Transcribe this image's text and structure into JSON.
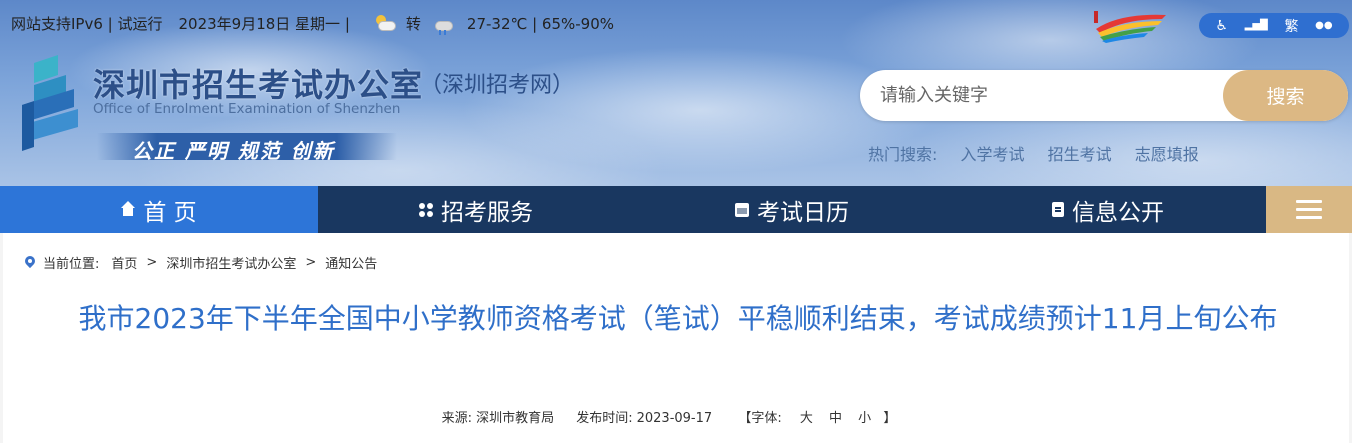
{
  "topbar": {
    "site_info": "网站支持IPv6 | 试运行",
    "date": "2023年9月18日 星期一 |",
    "weather_transition": "转",
    "weather_detail": "27-32℃ | 65%-90%",
    "weather_icons": [
      "sun-cloud-icon",
      "cloud-rain-icon"
    ]
  },
  "accessibility": {
    "items": [
      {
        "icon": "accessibility-icon",
        "label": "♿"
      },
      {
        "icon": "chart-icon",
        "label": "▂▅█"
      },
      {
        "icon": "traditional-chinese",
        "label": "繁"
      },
      {
        "icon": "wechat-icon",
        "label": "●●"
      }
    ]
  },
  "branding": {
    "title": "深圳市招生考试办公室",
    "subtitle": "（深圳招考网）",
    "english": "Office of Enrolment Examination of Shenzhen",
    "slogan": "公正 严明 规范 创新"
  },
  "search": {
    "placeholder": "请输入关键字",
    "button": "搜索",
    "hot_label": "热门搜索:",
    "hot_terms": [
      "入学考试",
      "招生考试",
      "志愿填报"
    ]
  },
  "nav": {
    "home": "首 页",
    "exam_services": "招考服务",
    "exam_calendar": "考试日历",
    "info_public": "信息公开"
  },
  "breadcrumb": {
    "label": "当前位置:",
    "items": [
      "首页",
      "深圳市招生考试办公室",
      "通知公告"
    ],
    "separator": ">"
  },
  "article": {
    "title": "我市2023年下半年全国中小学教师资格考试（笔试）平稳顺利结束，考试成绩预计11月上旬公布",
    "source_label": "来源:",
    "source": "深圳市教育局",
    "date_label": "发布时间:",
    "date": "2023-09-17",
    "font_size_label": "【字体:",
    "font_large": "大",
    "font_medium": "中",
    "font_small": "小",
    "font_close": "】"
  },
  "colors": {
    "nav_bg": "#193760",
    "nav_active": "#2d75d8",
    "accent_gold": "#dcb884",
    "title_blue": "#2f6fc9"
  }
}
